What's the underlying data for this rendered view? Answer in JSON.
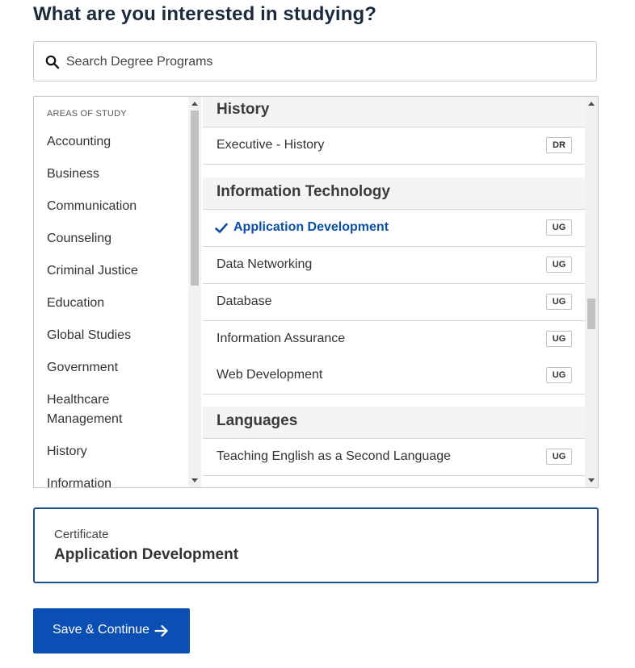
{
  "heading": "What are you interested in studying?",
  "search": {
    "placeholder": "Search Degree Programs",
    "value": ""
  },
  "areas": {
    "caption": "AREAS OF STUDY",
    "items": [
      "Accounting",
      "Business",
      "Communication",
      "Counseling",
      "Criminal Justice",
      "Education",
      "Global Studies",
      "Government",
      "Healthcare Management",
      "History",
      "Information"
    ]
  },
  "programs": {
    "groups": [
      {
        "title": "History",
        "items": [
          {
            "name": "Executive - History",
            "level": "DR"
          }
        ]
      },
      {
        "title": "Information Technology",
        "items": [
          {
            "name": "Application Development",
            "level": "UG",
            "selected": true
          },
          {
            "name": "Data Networking",
            "level": "UG"
          },
          {
            "name": "Database",
            "level": "UG"
          },
          {
            "name": "Information Assurance",
            "level": "UG"
          },
          {
            "name": "Web Development",
            "level": "UG"
          }
        ]
      },
      {
        "title": "Languages",
        "items": [
          {
            "name": "Teaching English as a Second Language",
            "level": "UG"
          }
        ]
      }
    ]
  },
  "selection": {
    "type": "Certificate",
    "program": "Application Development"
  },
  "save_button": {
    "label": "Save & Continue",
    "icon": "arrow-right-icon"
  },
  "colors": {
    "accent": "#0b4fb5",
    "selected_text": "#0a4fa8",
    "selection_border": "#1a4e8c",
    "heading": "#1b2a3d"
  },
  "icons": {
    "search": "search-icon",
    "check": "check-icon"
  }
}
